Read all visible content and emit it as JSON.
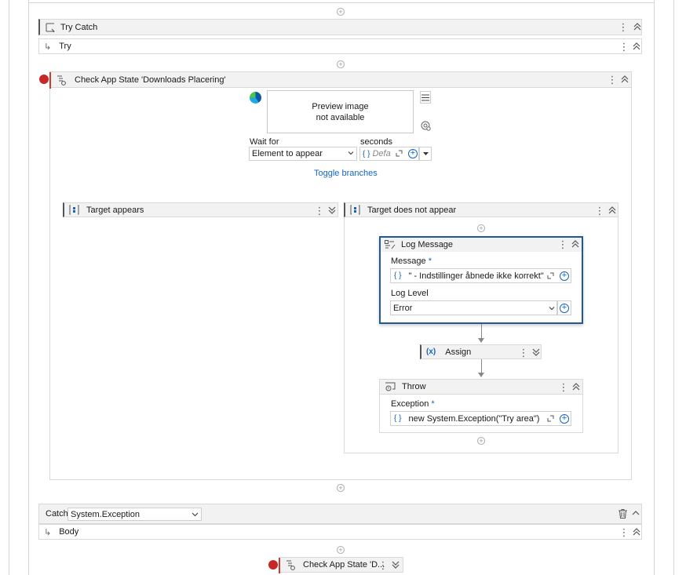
{
  "try_catch": {
    "title": "Try Catch"
  },
  "try": {
    "label": "Try"
  },
  "check_app_state": {
    "title": "Check App State 'Downloads Placering'"
  },
  "preview": {
    "line1": "Preview image",
    "line2": "not available"
  },
  "wait_for": {
    "label": "Wait for",
    "value": "Element to appear"
  },
  "seconds": {
    "label": "seconds",
    "placeholder": "Defa"
  },
  "toggle_branches": "Toggle branches",
  "target_appears": {
    "title": "Target appears"
  },
  "target_not_appear": {
    "title": "Target does not appear"
  },
  "log_message": {
    "title": "Log Message",
    "message_label": "Message",
    "required": "*",
    "message_value": "\" - Indstillinger åbnede ikke korrekt\"",
    "log_level_label": "Log Level",
    "log_level_value": "Error"
  },
  "assign": {
    "title": "Assign"
  },
  "throw": {
    "title": "Throw",
    "exception_label": "Exception",
    "required": "*",
    "exception_value": "new System.Exception(\"Try area\")"
  },
  "catch": {
    "label": "Catch",
    "exception_type": "System.Exception"
  },
  "body": {
    "label": "Body"
  },
  "bottom_activity": {
    "title": "Check App State 'D..."
  },
  "icons": {
    "brace": "{ }",
    "assign": "(x)"
  },
  "colors": {
    "accent": "#1565c0",
    "breakpoint": "#c62828",
    "selected_border": "#1f5a94"
  }
}
